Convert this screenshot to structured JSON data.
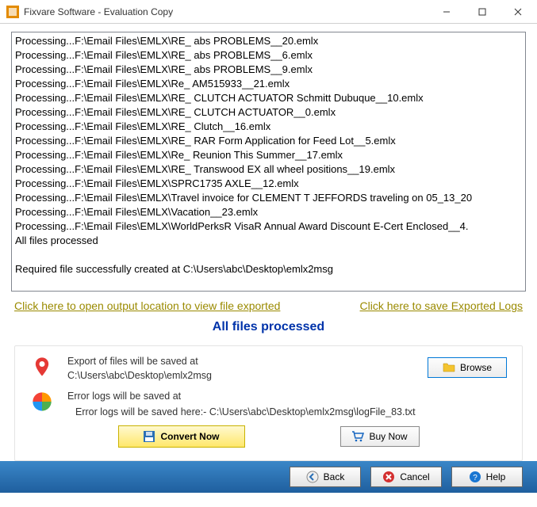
{
  "window": {
    "title": "Fixvare Software - Evaluation Copy"
  },
  "log_lines": [
    "Processing...F:\\Email Files\\EMLX\\RE_ abs PROBLEMS__20.emlx",
    "Processing...F:\\Email Files\\EMLX\\RE_ abs PROBLEMS__6.emlx",
    "Processing...F:\\Email Files\\EMLX\\RE_ abs PROBLEMS__9.emlx",
    "Processing...F:\\Email Files\\EMLX\\Re_ AM515933__21.emlx",
    "Processing...F:\\Email Files\\EMLX\\RE_ CLUTCH ACTUATOR Schmitt Dubuque__10.emlx",
    "Processing...F:\\Email Files\\EMLX\\RE_ CLUTCH ACTUATOR__0.emlx",
    "Processing...F:\\Email Files\\EMLX\\RE_ Clutch__16.emlx",
    "Processing...F:\\Email Files\\EMLX\\RE_ RAR Form Application for Feed Lot__5.emlx",
    "Processing...F:\\Email Files\\EMLX\\Re_ Reunion This Summer__17.emlx",
    "Processing...F:\\Email Files\\EMLX\\RE_ Transwood EX all wheel positions__19.emlx",
    "Processing...F:\\Email Files\\EMLX\\SPRC1735 AXLE__12.emlx",
    "Processing...F:\\Email Files\\EMLX\\Travel invoice for CLEMENT T JEFFORDS traveling on 05_13_20",
    "Processing...F:\\Email Files\\EMLX\\Vacation__23.emlx",
    "Processing...F:\\Email Files\\EMLX\\WorldPerksR VisaR Annual Award Discount E-Cert Enclosed__4.",
    "All files processed",
    "",
    "Required file successfully created at C:\\Users\\abc\\Desktop\\emlx2msg"
  ],
  "links": {
    "open_output": "Click here to open output location to view file exported",
    "save_logs": "Click here to save Exported Logs"
  },
  "status_text": "All files processed",
  "export": {
    "label": "Export of files will be saved at",
    "path": "C:\\Users\\abc\\Desktop\\emlx2msg",
    "browse_label": "Browse"
  },
  "errorlog": {
    "label": "Error logs will be saved at",
    "path": "Error logs will be saved here:- C:\\Users\\abc\\Desktop\\emlx2msg\\logFile_83.txt"
  },
  "buttons": {
    "convert": "Convert Now",
    "buy": "Buy Now",
    "back": "Back",
    "cancel": "Cancel",
    "help": "Help"
  }
}
